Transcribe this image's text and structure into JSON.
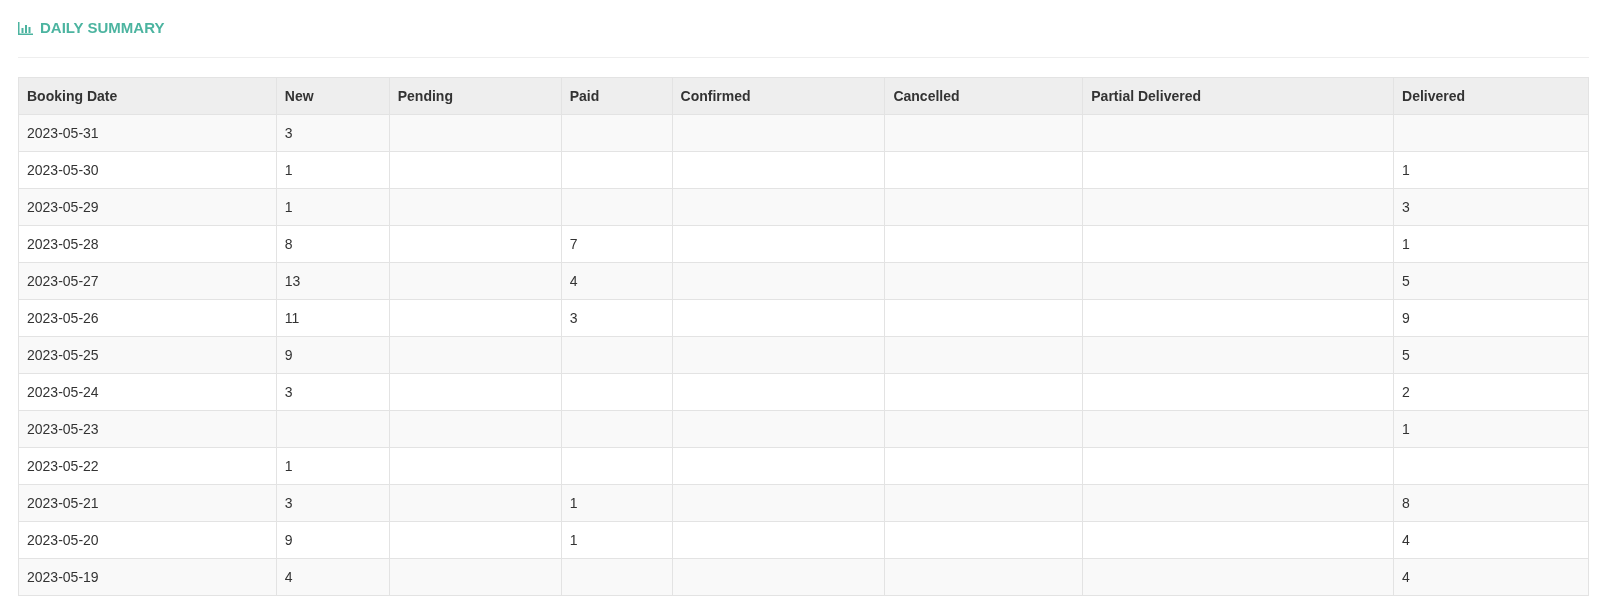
{
  "title": "DAILY SUMMARY",
  "table": {
    "columns": [
      "Booking Date",
      "New",
      "Pending",
      "Paid",
      "Confirmed",
      "Cancelled",
      "Partial Delivered",
      "Delivered"
    ],
    "rows": [
      [
        "2023-05-31",
        "3",
        "",
        "",
        "",
        "",
        "",
        ""
      ],
      [
        "2023-05-30",
        "1",
        "",
        "",
        "",
        "",
        "",
        "1"
      ],
      [
        "2023-05-29",
        "1",
        "",
        "",
        "",
        "",
        "",
        "3"
      ],
      [
        "2023-05-28",
        "8",
        "",
        "7",
        "",
        "",
        "",
        "1"
      ],
      [
        "2023-05-27",
        "13",
        "",
        "4",
        "",
        "",
        "",
        "5"
      ],
      [
        "2023-05-26",
        "11",
        "",
        "3",
        "",
        "",
        "",
        "9"
      ],
      [
        "2023-05-25",
        "9",
        "",
        "",
        "",
        "",
        "",
        "5"
      ],
      [
        "2023-05-24",
        "3",
        "",
        "",
        "",
        "",
        "",
        "2"
      ],
      [
        "2023-05-23",
        "",
        "",
        "",
        "",
        "",
        "",
        "1"
      ],
      [
        "2023-05-22",
        "1",
        "",
        "",
        "",
        "",
        "",
        ""
      ],
      [
        "2023-05-21",
        "3",
        "",
        "1",
        "",
        "",
        "",
        "8"
      ],
      [
        "2023-05-20",
        "9",
        "",
        "1",
        "",
        "",
        "",
        "4"
      ],
      [
        "2023-05-19",
        "4",
        "",
        "",
        "",
        "",
        "",
        "4"
      ]
    ]
  }
}
